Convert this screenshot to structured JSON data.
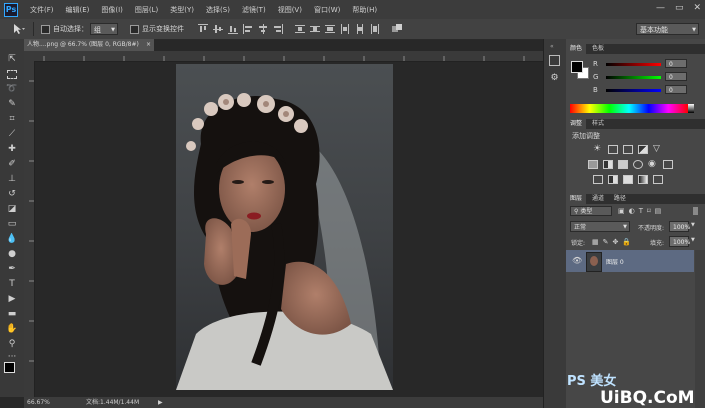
{
  "app": {
    "logo": "Ps"
  },
  "menu": [
    "文件(F)",
    "编辑(E)",
    "图像(I)",
    "图层(L)",
    "类型(Y)",
    "选择(S)",
    "滤镜(T)",
    "视图(V)",
    "窗口(W)",
    "帮助(H)"
  ],
  "window_controls": {
    "minimize": "—",
    "restore": "▭",
    "close": "✕"
  },
  "options": {
    "auto_select_label": "自动选择：",
    "auto_select_value": "组",
    "show_transform_label": "显示变换控件",
    "workspace": "基本功能"
  },
  "document": {
    "tab_title": "人物....png @ 66.7% (图层 0, RGB/8#)",
    "zoom": "66.67%",
    "doc_info": "文档:1.44M/1.44M"
  },
  "color_panel": {
    "tabs": [
      "颜色",
      "色板"
    ],
    "r_label": "R",
    "g_label": "G",
    "b_label": "B",
    "r": "0",
    "g": "0",
    "b": "0"
  },
  "adjustments_panel": {
    "tabs": [
      "调整",
      "样式"
    ],
    "title": "添加调整"
  },
  "layers_panel": {
    "tabs": [
      "图层",
      "通道",
      "路径"
    ],
    "filter": "类型",
    "blend_mode": "正常",
    "opacity_label": "不透明度:",
    "opacity": "100%",
    "lock_label": "锁定:",
    "fill_label": "填充:",
    "fill": "100%",
    "layers": [
      {
        "name": "图层 0"
      }
    ]
  },
  "watermark": {
    "brand": "PS 美女",
    "site": "UiBQ.CoM"
  },
  "colors": {
    "accent": "#31a8ff",
    "selected_layer": "#5d6a82"
  }
}
